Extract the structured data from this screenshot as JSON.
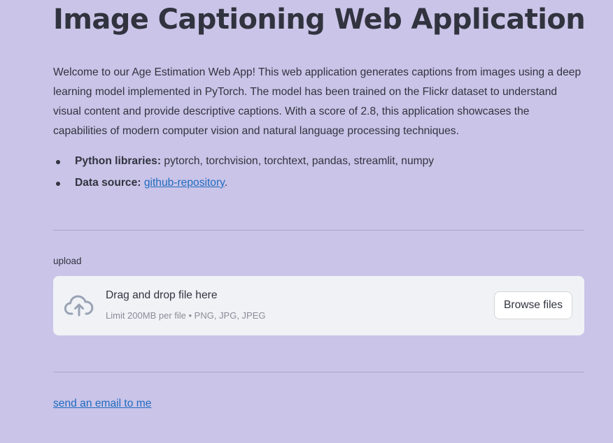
{
  "header": {
    "title": "Image Captioning Web Application"
  },
  "intro": {
    "text": "Welcome to our Age Estimation Web App! This web application generates captions from images using a deep learning model implemented in PyTorch. The model has been trained on the Flickr dataset to understand visual content and provide descriptive captions. With a score of 2.8, this application showcases the capabilities of modern computer vision and natural language processing techniques."
  },
  "meta": {
    "libraries_label": "Python libraries:",
    "libraries_value": "pytorch, torchvision, torchtext, pandas, streamlit, numpy",
    "source_label": "Data source:",
    "source_link": "github-repository",
    "source_suffix": "."
  },
  "uploader": {
    "label": "upload",
    "drop_title": "Drag and drop file here",
    "drop_hint": "Limit 200MB per file • PNG, JPG, JPEG",
    "browse_label": "Browse files",
    "icon": "cloud-upload-icon"
  },
  "footer": {
    "email_link": "send an email to me"
  },
  "colors": {
    "background": "#cac4e8",
    "text": "#31333f",
    "link": "#1f6bbf",
    "dropzone": "#f0f2f6",
    "icon": "#9aa3b5"
  }
}
